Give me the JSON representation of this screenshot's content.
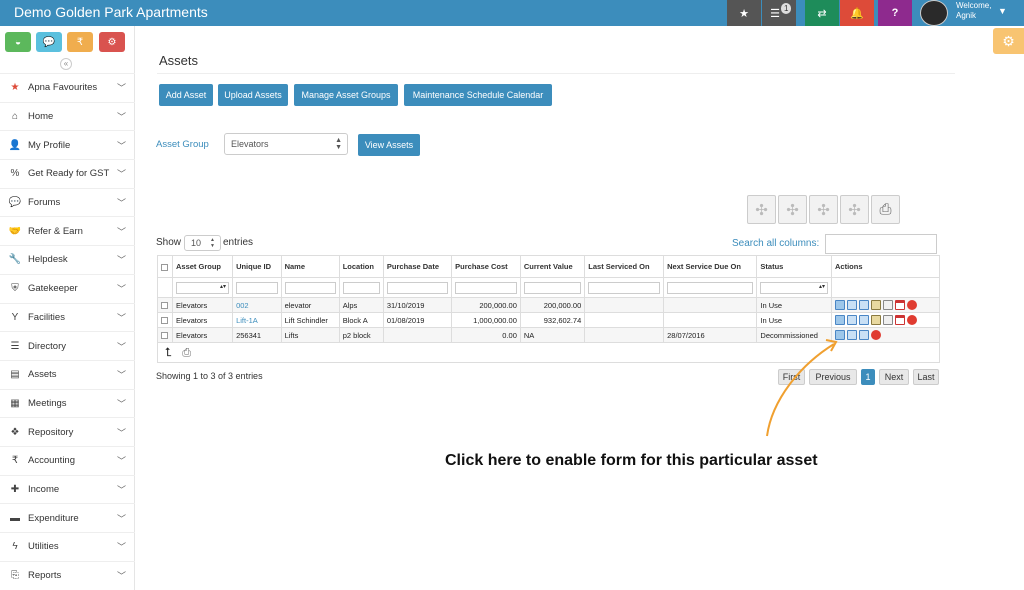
{
  "app": {
    "title": "Demo Golden Park Apartments"
  },
  "topbar": {
    "notification_count": "1",
    "welcome": "Welcome,",
    "user": "Agnik"
  },
  "sidebar": {
    "items": [
      {
        "label": "Apna Favourites"
      },
      {
        "label": "Home"
      },
      {
        "label": "My Profile"
      },
      {
        "label": "Get Ready for GST"
      },
      {
        "label": "Forums"
      },
      {
        "label": "Refer & Earn"
      },
      {
        "label": "Helpdesk"
      },
      {
        "label": "Gatekeeper"
      },
      {
        "label": "Facilities"
      },
      {
        "label": "Directory"
      },
      {
        "label": "Assets"
      },
      {
        "label": "Meetings"
      },
      {
        "label": "Repository"
      },
      {
        "label": "Accounting"
      },
      {
        "label": "Income"
      },
      {
        "label": "Expenditure"
      },
      {
        "label": "Utilities"
      },
      {
        "label": "Reports"
      }
    ]
  },
  "page": {
    "title": "Assets",
    "buttons": {
      "add": "Add Asset",
      "upload": "Upload Assets",
      "manage_groups": "Manage Asset Groups",
      "calendar": "Maintenance Schedule Calendar"
    },
    "asset_group_label": "Asset Group",
    "asset_group_value": "Elevators",
    "view_assets": "View Assets",
    "show_label": "Show",
    "show_value": "10",
    "entries_label": "entries",
    "search_label": "Search all columns:",
    "showing": "Showing 1 to 3 of 3 entries"
  },
  "table": {
    "headers": [
      "Asset Group",
      "Unique ID",
      "Name",
      "Location",
      "Purchase Date",
      "Purchase Cost",
      "Current Value",
      "Last Serviced On",
      "Next Service Due On",
      "Status",
      "Actions"
    ],
    "rows": [
      {
        "group": "Elevators",
        "uid": "002",
        "name": "elevator",
        "location": "Alps",
        "pdate": "31/10/2019",
        "pcost": "200,000.00",
        "cvalue": "200,000.00",
        "last": "",
        "next": "",
        "status": "In Use"
      },
      {
        "group": "Elevators",
        "uid": "Lift-1A",
        "name": "Lift Schindler",
        "location": "Block A",
        "pdate": "01/08/2019",
        "pcost": "1,000,000.00",
        "cvalue": "932,602.74",
        "last": "",
        "next": "",
        "status": "In Use"
      },
      {
        "group": "Elevators",
        "uid": "256341",
        "name": "Lifts",
        "location": "p2 block",
        "pdate": "",
        "pcost": "0.00",
        "cvalue": "NA",
        "last": "",
        "next": "28/07/2016",
        "status": "Decommissioned"
      }
    ]
  },
  "pagination": {
    "first": "First",
    "previous": "Previous",
    "current": "1",
    "next": "Next",
    "last": "Last"
  },
  "annotation": {
    "text": "Click here to enable form for this particular asset"
  },
  "colors": {
    "primary": "#3c8dbc",
    "arrow": "#f0a030"
  }
}
